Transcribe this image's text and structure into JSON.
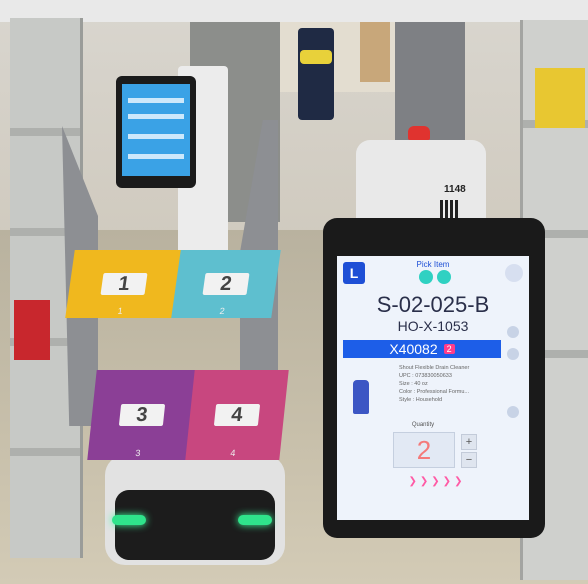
{
  "scene": {
    "description_free": true
  },
  "cart_tiles": [
    {
      "label": "1",
      "sub": "1",
      "color": "#f0b81e"
    },
    {
      "label": "2",
      "sub": "2",
      "color": "#5ebfcf"
    },
    {
      "label": "3",
      "sub": "3",
      "color": "#8b3f96"
    },
    {
      "label": "4",
      "sub": "4",
      "color": "#c8477f"
    }
  ],
  "robot2": {
    "id_label": "1148"
  },
  "tablet": {
    "logo": "L",
    "title": "Pick Item",
    "location": "S-02-025-B",
    "location_sub": "HO-X-1053",
    "item_code": "X40082",
    "item_badge": "2",
    "details": [
      "Shout Flexible Drain Cleaner",
      "UPC : 073830050633",
      "Size : 40 oz",
      "Color : Professional Formu...",
      "Style : Household"
    ],
    "quantity_label": "Quantity",
    "quantity_value": "2",
    "qty_plus": "+",
    "qty_minus": "−",
    "arrows": "❯❯❯❯❯"
  },
  "colors": {
    "accent_blue": "#1d5ee8",
    "badge_pink": "#ff3c8a",
    "glow_green": "#2fe38b"
  }
}
